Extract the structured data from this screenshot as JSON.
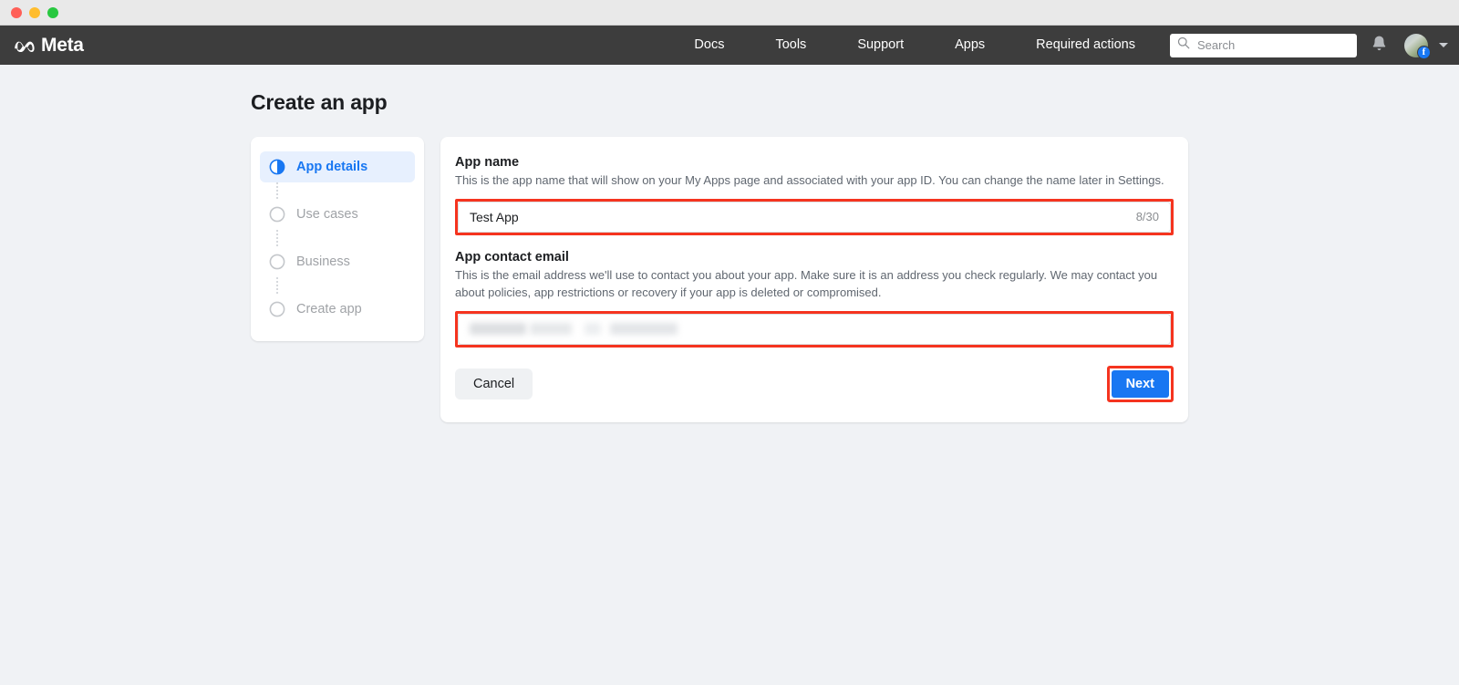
{
  "window": {
    "traffic_lights": [
      "close",
      "minimize",
      "maximize"
    ]
  },
  "topnav": {
    "brand": "Meta",
    "brand_icon": "meta-infinity-logo",
    "links": [
      {
        "label": "Docs"
      },
      {
        "label": "Tools"
      },
      {
        "label": "Support"
      },
      {
        "label": "Apps"
      },
      {
        "label": "Required actions"
      }
    ],
    "search": {
      "placeholder": "Search",
      "value": "",
      "icon": "search-icon"
    },
    "notifications_icon": "bell-icon",
    "avatar": {
      "badge_icon": "facebook-badge-icon",
      "badge_letter": "f"
    },
    "account_chevron_icon": "chevron-down-icon",
    "colors": {
      "nav_background": "#3d3d3d",
      "nav_text": "#ffffff"
    }
  },
  "page": {
    "title": "Create an app",
    "background": "#f0f2f5"
  },
  "stepper": {
    "steps": [
      {
        "label": "App details",
        "state": "active",
        "icon": "half-filled-circle-icon"
      },
      {
        "label": "Use cases",
        "state": "inactive",
        "icon": "empty-circle-icon"
      },
      {
        "label": "Business",
        "state": "inactive",
        "icon": "empty-circle-icon"
      },
      {
        "label": "Create app",
        "state": "inactive",
        "icon": "empty-circle-icon"
      }
    ],
    "active_color": "#1877f2",
    "inactive_color": "#a0a3a7"
  },
  "form": {
    "app_name": {
      "label": "App name",
      "description": "This is the app name that will show on your My Apps page and associated with your app ID. You can change the name later in Settings.",
      "value": "Test App",
      "placeholder": "",
      "counter": "8/30",
      "highlighted": true,
      "highlight_color": "#f5341f"
    },
    "app_contact_email": {
      "label": "App contact email",
      "description": "This is the email address we'll use to contact you about your app. Make sure it is an address you check regularly. We may contact you about policies, app restrictions or recovery if your app is deleted or compromised.",
      "value": "",
      "placeholder": "",
      "redacted": true,
      "highlighted": true,
      "highlight_color": "#f5341f"
    },
    "cancel_label": "Cancel",
    "next_label": "Next",
    "next_highlighted": true,
    "next_color": "#1877f2"
  }
}
